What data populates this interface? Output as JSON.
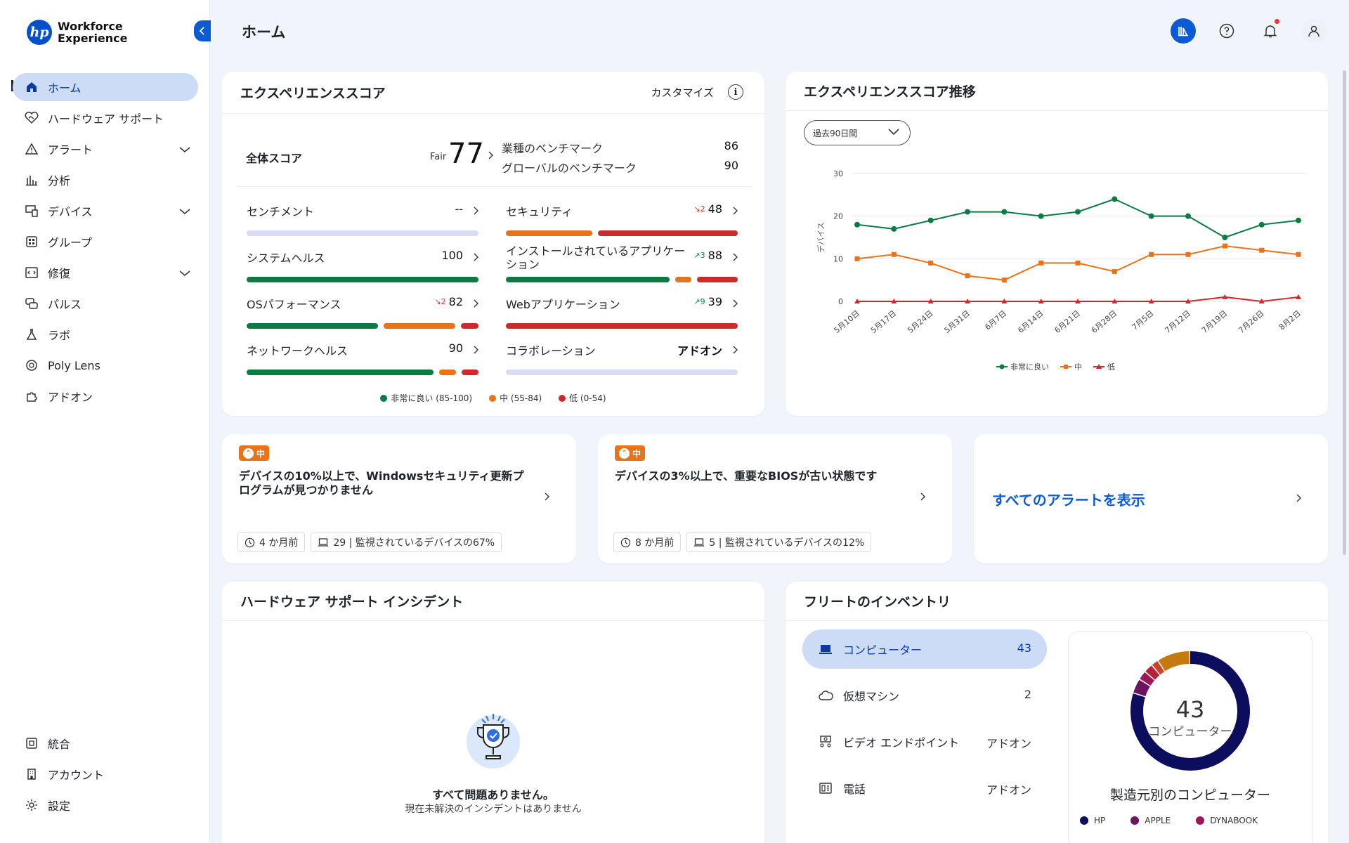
{
  "app": {
    "logo_text_line1": "Workforce",
    "logo_text_line2": "Experience",
    "hp_mark": "hp"
  },
  "sidebar": {
    "items": [
      {
        "label": "ホーム",
        "icon": "home-icon",
        "active": true
      },
      {
        "label": "ハードウェア サポート",
        "icon": "heart-handshake-icon"
      },
      {
        "label": "アラート",
        "icon": "warning-triangle-icon",
        "expand": true
      },
      {
        "label": "分析",
        "icon": "bar-chart-icon"
      },
      {
        "label": "デバイス",
        "icon": "devices-icon",
        "expand": true
      },
      {
        "label": "グループ",
        "icon": "grid-icon"
      },
      {
        "label": "修復",
        "icon": "code-window-icon",
        "expand": true
      },
      {
        "label": "パルス",
        "icon": "chat-bubbles-icon"
      },
      {
        "label": "ラボ",
        "icon": "flask-icon"
      },
      {
        "label": "Poly Lens",
        "icon": "lens-icon"
      },
      {
        "label": "アドオン",
        "icon": "puzzle-icon"
      }
    ],
    "bottom_items": [
      {
        "label": "統合",
        "icon": "integration-icon"
      },
      {
        "label": "アカウント",
        "icon": "building-icon"
      },
      {
        "label": "設定",
        "icon": "gear-icon"
      }
    ]
  },
  "header": {
    "title": "ホーム"
  },
  "score_card": {
    "title": "エクスペリエンススコア",
    "customize_label": "カスタマイズ",
    "overall_label": "全体スコア",
    "overall_rating": "Fair",
    "overall_value": "77",
    "bench_industry_label": "業種のベンチマーク",
    "bench_industry_value": "86",
    "bench_global_label": "グローバルのベンチマーク",
    "bench_global_value": "90",
    "metrics": {
      "sentiment": {
        "name": "センチメント",
        "value": "--"
      },
      "security": {
        "name": "セキュリティ",
        "value": "48",
        "trend": "↘2"
      },
      "system": {
        "name": "システムヘルス",
        "value": "100"
      },
      "apps": {
        "name": "インストールされているアプリケーション",
        "value": "88",
        "trend": "↗3"
      },
      "os": {
        "name": "OSパフォーマンス",
        "value": "82",
        "trend": "↘2"
      },
      "web": {
        "name": "Webアプリケーション",
        "value": "39",
        "trend": "↗9"
      },
      "network": {
        "name": "ネットワークヘルス",
        "value": "90"
      },
      "collab": {
        "name": "コラボレーション",
        "value": "アドオン"
      }
    },
    "legend": {
      "good": "非常に良い (85-100)",
      "mid": "中 (55-84)",
      "low": "低 (0-54)"
    },
    "colors": {
      "good": "#0b7a43",
      "mid": "#e8731a",
      "low": "#cf2a2a"
    }
  },
  "trend_card": {
    "title": "エクスペリエンススコア推移",
    "period": "過去90日間"
  },
  "chart_data": {
    "type": "line",
    "title": "",
    "xlabel": "",
    "ylabel": "デバイス",
    "ylim": [
      0,
      30
    ],
    "yticks": [
      "0",
      "10",
      "20",
      "30"
    ],
    "categories": [
      "5月10日",
      "5月17日",
      "5月24日",
      "5月31日",
      "6月7日",
      "6月14日",
      "6月21日",
      "6月28日",
      "7月5日",
      "7月12日",
      "7月19日",
      "7月26日",
      "8月2日"
    ],
    "series": [
      {
        "name": "非常に良い",
        "color": "#0b7a43",
        "marker": "circle",
        "values": [
          18,
          17,
          19,
          21,
          21,
          20,
          21,
          24,
          20,
          20,
          15,
          18,
          19
        ]
      },
      {
        "name": "中",
        "color": "#e8731a",
        "marker": "square",
        "values": [
          10,
          11,
          9,
          6,
          5,
          9,
          9,
          7,
          11,
          11,
          13,
          12,
          11
        ]
      },
      {
        "name": "低",
        "color": "#cf2a2a",
        "marker": "triangle",
        "values": [
          0,
          0,
          0,
          0,
          0,
          0,
          0,
          0,
          0,
          0,
          1,
          0,
          1
        ]
      }
    ],
    "grid": true,
    "legend": "bottom"
  },
  "alerts": [
    {
      "badge": "中",
      "text": "デバイスの10%以上で、Windowsセキュリティ更新プログラムが見つかりません",
      "time": "4 か月前",
      "devices": "29 | 監視されているデバイスの67%"
    },
    {
      "badge": "中",
      "text": "デバイスの3%以上で、重要なBIOSが古い状態です",
      "time": "8 か月前",
      "devices": "5 | 監視されているデバイスの12%"
    }
  ],
  "all_alerts_label": "すべてのアラートを表示",
  "incident_card": {
    "title": "ハードウェア サポート インシデント",
    "ok_text": "すべて問題ありません。",
    "sub_text": "現在未解決のインシデントはありません"
  },
  "inventory_card": {
    "title": "フリートのインベントリ",
    "items": [
      {
        "label": "コンピューター",
        "value": "43",
        "icon": "laptop-icon"
      },
      {
        "label": "仮想マシン",
        "value": "2",
        "icon": "cloud-icon"
      },
      {
        "label": "ビデオ エンドポイント",
        "value": "アドオン",
        "icon": "video-endpoint-icon"
      },
      {
        "label": "電話",
        "value": "アドオン",
        "icon": "phone-icon"
      }
    ],
    "donut_total": "43",
    "donut_label": "コンピューター",
    "donut_title": "製造元別のコンピューター",
    "manufacturers": [
      {
        "name": "HP",
        "color": "#0d0d5e",
        "share": 0.8
      },
      {
        "name": "APPLE",
        "color": "#6b1460",
        "share": 0.04
      },
      {
        "name": "DYNABOOK",
        "color": "#9a1855",
        "share": 0.025
      },
      {
        "name": "",
        "color": "#b5223a",
        "share": 0.025
      },
      {
        "name": "",
        "color": "#c8432a",
        "share": 0.02
      },
      {
        "name": "",
        "color": "#c57a10",
        "share": 0.09
      }
    ]
  }
}
